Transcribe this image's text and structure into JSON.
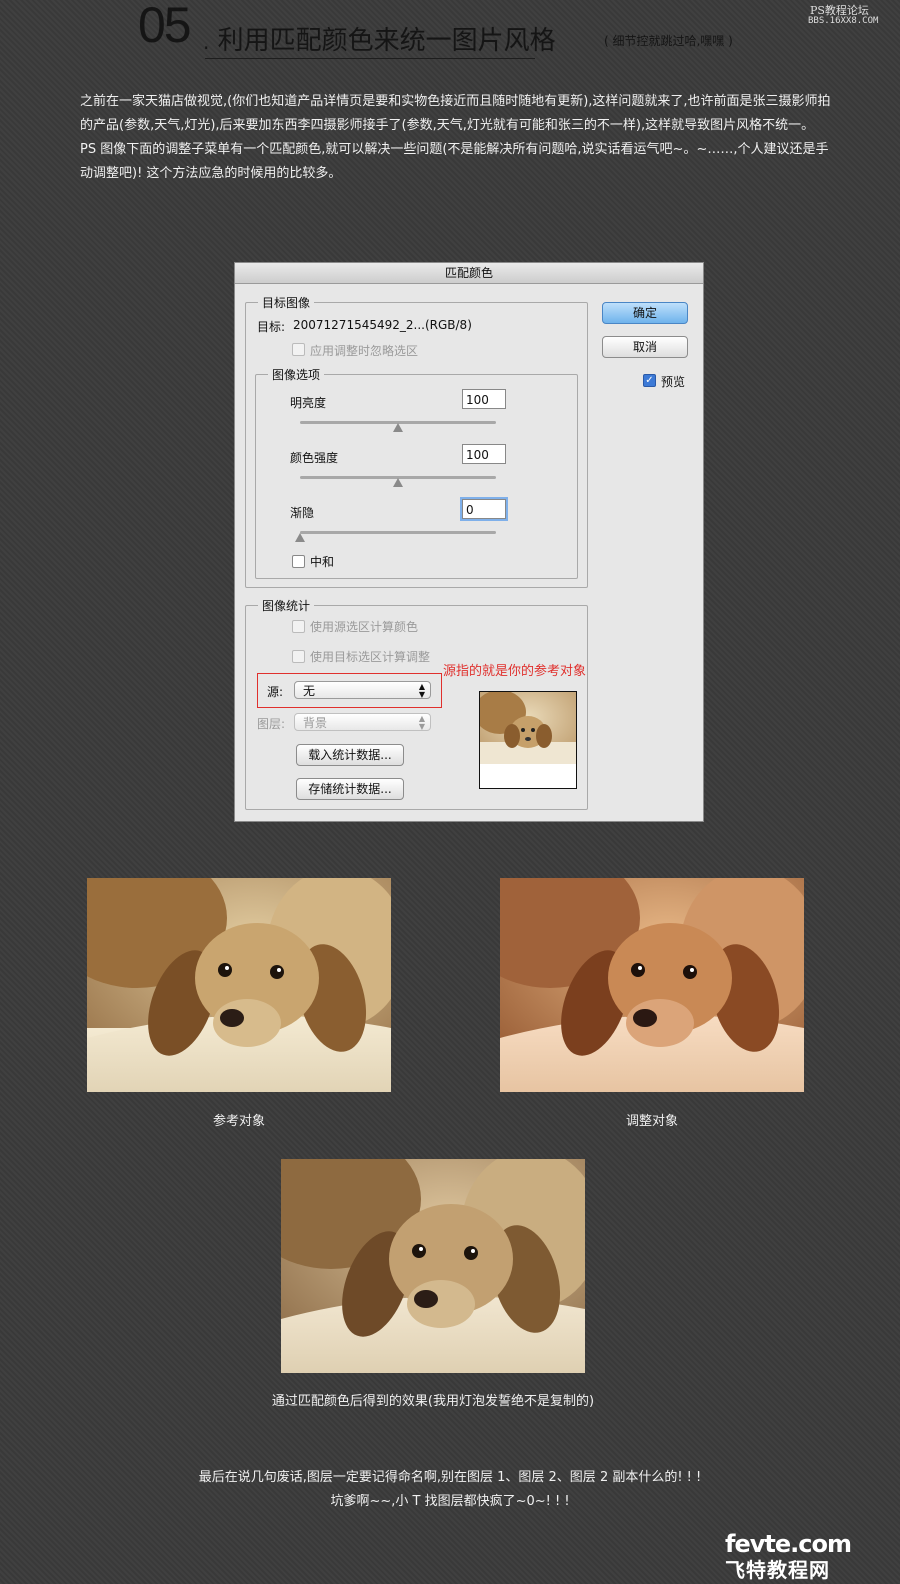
{
  "header": {
    "number": "05",
    "dot": ".",
    "title": "利用匹配颜色来统一图片风格",
    "note": "( 细节控就跳过哈,嘿嘿 )",
    "site_name": "PS教程论坛",
    "site_url": "BBS.16XX8.COM"
  },
  "intro": {
    "paragraphs": [
      "之前在一家天猫店做视觉,(你们也知道产品详情页是要和实物色接近而且随时随地有更新),这样问题就来了,也许前面是张三摄影师拍的产品(参数,天气,灯光),后来要加东西李四摄影师接手了(参数,天气,灯光就有可能和张三的不一样),这样就导致图片风格不统一。",
      "PS 图像下面的调整子菜单有一个匹配颜色,就可以解决一些问题(不是能解决所有问题哈,说实话看运气吧~。~……,个人建议还是手动调整吧)! 这个方法应急的时候用的比较多。"
    ]
  },
  "dialog": {
    "title": "匹配颜色",
    "target_group": {
      "legend": "目标图像",
      "target_label": "目标:",
      "target_value": "20071271545492_2...(RGB/8)",
      "ignore_selection": "应用调整时忽略选区"
    },
    "options_group": {
      "legend": "图像选项",
      "luminance_label": "明亮度",
      "luminance_value": "100",
      "luminance_level": 0.5,
      "intensity_label": "颜色强度",
      "intensity_value": "100",
      "intensity_level": 0.5,
      "fade_label": "渐隐",
      "fade_value": "0",
      "fade_level": 0.0,
      "neutralize_label": "中和"
    },
    "stats_group": {
      "legend": "图像统计",
      "use_source_selection": "使用源选区计算颜色",
      "use_target_selection": "使用目标选区计算调整",
      "source_label": "源:",
      "source_value": "无",
      "layer_label": "图层:",
      "layer_value": "背景",
      "load_stats": "载入统计数据...",
      "save_stats": "存储统计数据..."
    },
    "buttons": {
      "ok": "确定",
      "cancel": "取消",
      "preview": "预览",
      "preview_checked": "✓"
    },
    "annotation": "源指的就是你的参考对象"
  },
  "photos": {
    "reference_caption": "参考对象",
    "adjust_caption": "调整对象",
    "result_caption": "通过匹配颜色后得到的效果(我用灯泡发誓绝不是复制的)"
  },
  "outro": {
    "lines": [
      "最后在说几句废话,图层一定要记得命名啊,别在图层 1、图层 2、图层 2 副本什么的! ! !",
      "坑爹啊~~,小 T 找图层都快疯了~0~! ! !"
    ]
  },
  "watermark": {
    "domain": "fevte.com",
    "name": "飞特教程网"
  }
}
